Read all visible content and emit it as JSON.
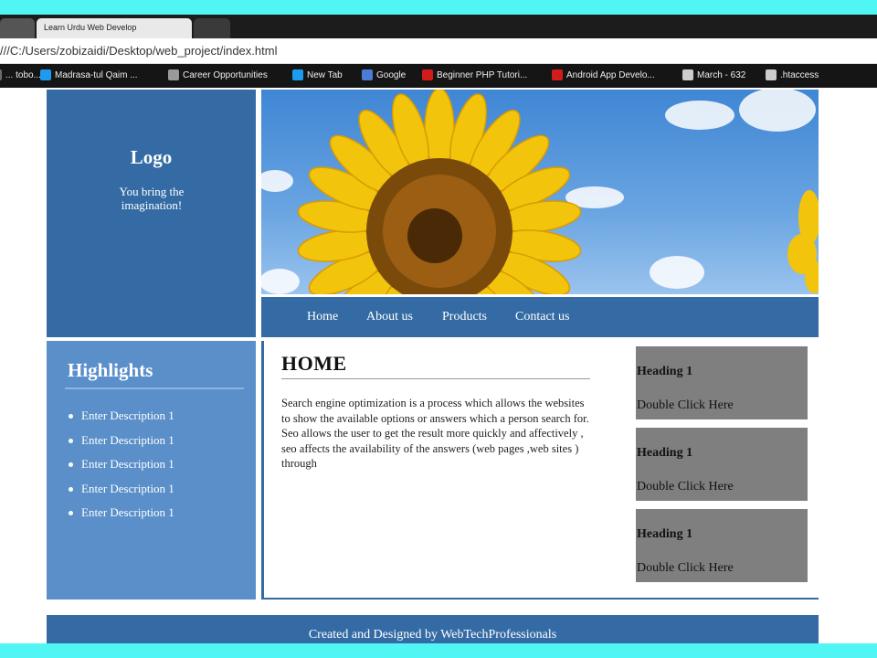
{
  "browser": {
    "active_tab_title": "Learn Urdu Web Develop",
    "address": "///C:/Users/zobizaidi/Desktop/web_project/index.html",
    "bookmarks": [
      {
        "label": "... tobo...",
        "icon": "page-icon",
        "color": "#6b6b6b"
      },
      {
        "label": "Madrasa-tul Qaim ...",
        "icon": "twitter-icon",
        "color": "#1d9bf0"
      },
      {
        "label": "Career Opportunities",
        "icon": "page-icon",
        "color": "#9a9a9a"
      },
      {
        "label": "New Tab",
        "icon": "twitter-icon",
        "color": "#1d9bf0"
      },
      {
        "label": "Google",
        "icon": "google-icon",
        "color": "#4a7bd6"
      },
      {
        "label": "Beginner PHP Tutori...",
        "icon": "youtube-icon",
        "color": "#d21c1c"
      },
      {
        "label": "Android App Develo...",
        "icon": "youtube-icon",
        "color": "#d21c1c"
      },
      {
        "label": "March - 632",
        "icon": "pen-icon",
        "color": "#cccccc"
      },
      {
        "label": ".htaccess",
        "icon": "gear-icon",
        "color": "#cccccc"
      }
    ]
  },
  "site": {
    "logo": "Logo",
    "tagline": "You bring the imagination!",
    "nav": [
      "Home",
      "About us",
      "Products",
      "Contact us"
    ],
    "highlights": {
      "title": "Highlights",
      "items": [
        "Enter Description 1",
        "Enter Description 1",
        "Enter Description 1",
        "Enter Description 1",
        "Enter Description 1"
      ]
    },
    "main": {
      "title": "HOME",
      "body": "Search engine optimization is a process which allows the websites to show the available options or answers which a person search for. Seo allows the user to get the result more quickly and affectively , seo affects the availability of the answers (web pages ,web sites ) through"
    },
    "side_boxes": [
      {
        "heading": "Heading 1",
        "text": "Double Click Here"
      },
      {
        "heading": "Heading 1",
        "text": "Double Click Here"
      },
      {
        "heading": "Heading 1",
        "text": "Double Click Here"
      }
    ],
    "footer": "Created and Designed by WebTechProfessionals"
  },
  "colors": {
    "primary": "#346ba4",
    "highlights_bg": "#5a8fc9",
    "side_box_bg": "#7f7f7f",
    "outer_bg": "#4ff6f4"
  }
}
